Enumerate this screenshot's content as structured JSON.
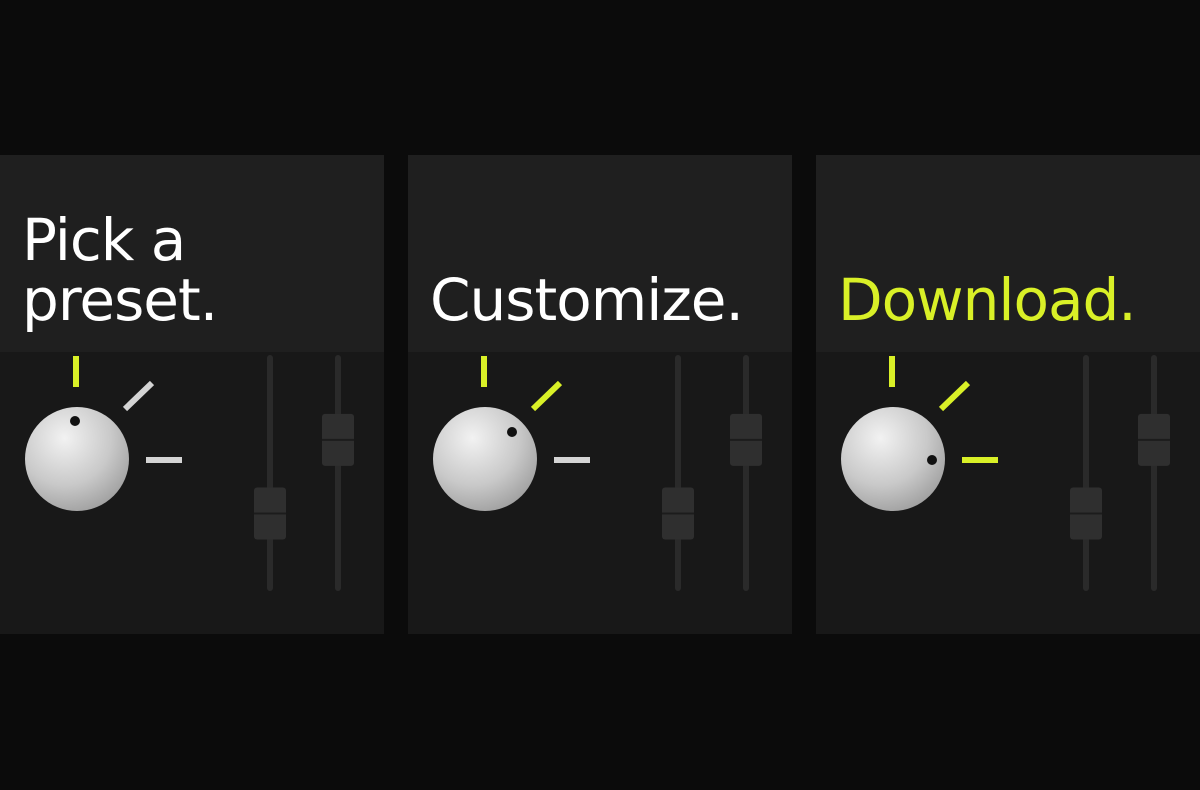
{
  "colors": {
    "background": "#0b0b0b",
    "card_header": "#1f1f1f",
    "card_body": "#181818",
    "accent": "#d9f027",
    "inactive_tick": "#d4d4d4",
    "title": "#ffffff"
  },
  "steps": [
    {
      "title_lines": [
        "Pick a",
        "preset."
      ],
      "title_accent": false,
      "knob": {
        "icon": "rotary-knob-icon",
        "position_index": 0,
        "ticks_lit": 1
      },
      "sliders": [
        {
          "level": 0.28
        },
        {
          "level": 0.68
        }
      ]
    },
    {
      "title_lines": [
        "Customize."
      ],
      "title_accent": false,
      "knob": {
        "icon": "rotary-knob-icon",
        "position_index": 1,
        "ticks_lit": 2
      },
      "sliders": [
        {
          "level": 0.28
        },
        {
          "level": 0.68
        }
      ]
    },
    {
      "title_lines": [
        "Download."
      ],
      "title_accent": true,
      "knob": {
        "icon": "rotary-knob-icon",
        "position_index": 2,
        "ticks_lit": 3
      },
      "sliders": [
        {
          "level": 0.28
        },
        {
          "level": 0.68
        }
      ]
    }
  ]
}
